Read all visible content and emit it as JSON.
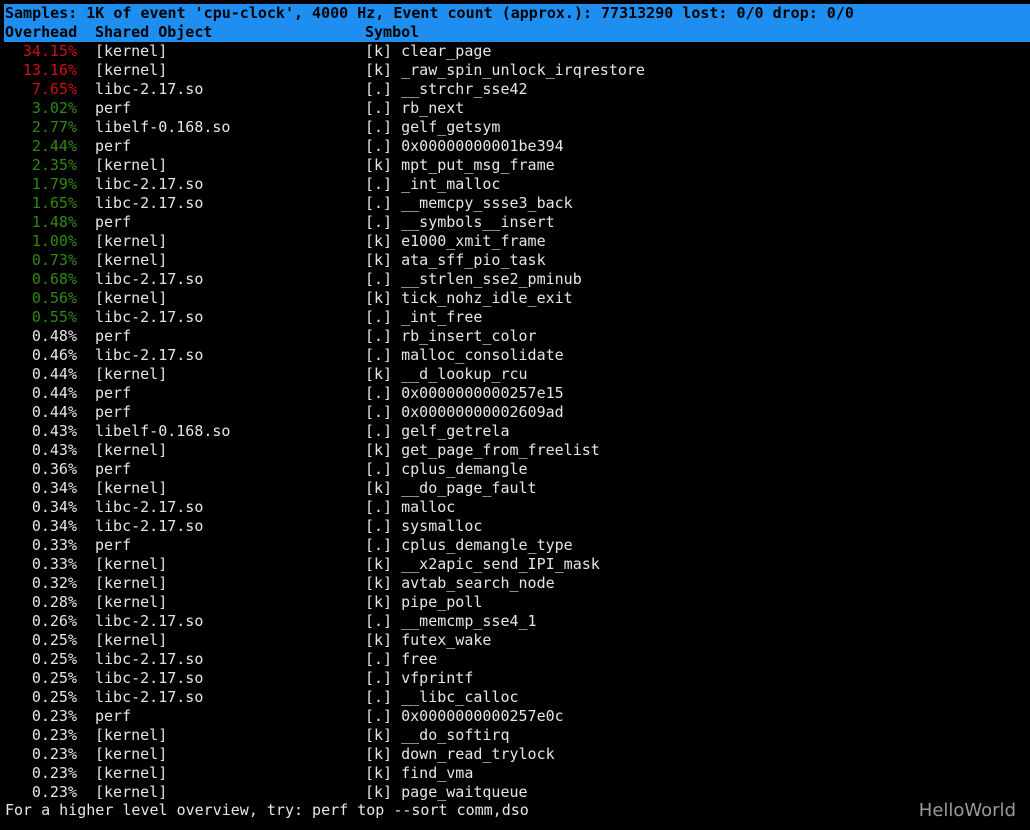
{
  "header": {
    "summary": "Samples: 1K of event 'cpu-clock', 4000 Hz, Event count (approx.): 77313290 lost: 0/0 drop: 0/0",
    "columns": [
      "Overhead",
      "Shared Object",
      "Symbol"
    ]
  },
  "colors": {
    "header_bg": "#1e8ff0",
    "high": "#d01010",
    "medium": "#2f8a10",
    "normal": "#e6e6e6"
  },
  "rows": [
    {
      "overhead": "34.15%",
      "object": "[kernel]",
      "symbol": "[k] clear_page",
      "level": "high"
    },
    {
      "overhead": "13.16%",
      "object": "[kernel]",
      "symbol": "[k] _raw_spin_unlock_irqrestore",
      "level": "high"
    },
    {
      "overhead": "7.65%",
      "object": "libc-2.17.so",
      "symbol": "[.] __strchr_sse42",
      "level": "high"
    },
    {
      "overhead": "3.02%",
      "object": "perf",
      "symbol": "[.] rb_next",
      "level": "medium"
    },
    {
      "overhead": "2.77%",
      "object": "libelf-0.168.so",
      "symbol": "[.] gelf_getsym",
      "level": "medium"
    },
    {
      "overhead": "2.44%",
      "object": "perf",
      "symbol": "[.] 0x00000000001be394",
      "level": "medium"
    },
    {
      "overhead": "2.35%",
      "object": "[kernel]",
      "symbol": "[k] mpt_put_msg_frame",
      "level": "medium"
    },
    {
      "overhead": "1.79%",
      "object": "libc-2.17.so",
      "symbol": "[.] _int_malloc",
      "level": "medium"
    },
    {
      "overhead": "1.65%",
      "object": "libc-2.17.so",
      "symbol": "[.] __memcpy_ssse3_back",
      "level": "medium"
    },
    {
      "overhead": "1.48%",
      "object": "perf",
      "symbol": "[.] __symbols__insert",
      "level": "medium"
    },
    {
      "overhead": "1.00%",
      "object": "[kernel]",
      "symbol": "[k] e1000_xmit_frame",
      "level": "medium"
    },
    {
      "overhead": "0.73%",
      "object": "[kernel]",
      "symbol": "[k] ata_sff_pio_task",
      "level": "medium"
    },
    {
      "overhead": "0.68%",
      "object": "libc-2.17.so",
      "symbol": "[.] __strlen_sse2_pminub",
      "level": "medium"
    },
    {
      "overhead": "0.56%",
      "object": "[kernel]",
      "symbol": "[k] tick_nohz_idle_exit",
      "level": "medium"
    },
    {
      "overhead": "0.55%",
      "object": "libc-2.17.so",
      "symbol": "[.] _int_free",
      "level": "medium"
    },
    {
      "overhead": "0.48%",
      "object": "perf",
      "symbol": "[.] rb_insert_color",
      "level": "normal"
    },
    {
      "overhead": "0.46%",
      "object": "libc-2.17.so",
      "symbol": "[.] malloc_consolidate",
      "level": "normal"
    },
    {
      "overhead": "0.44%",
      "object": "[kernel]",
      "symbol": "[k] __d_lookup_rcu",
      "level": "normal"
    },
    {
      "overhead": "0.44%",
      "object": "perf",
      "symbol": "[.] 0x0000000000257e15",
      "level": "normal"
    },
    {
      "overhead": "0.44%",
      "object": "perf",
      "symbol": "[.] 0x00000000002609ad",
      "level": "normal"
    },
    {
      "overhead": "0.43%",
      "object": "libelf-0.168.so",
      "symbol": "[.] gelf_getrela",
      "level": "normal"
    },
    {
      "overhead": "0.43%",
      "object": "[kernel]",
      "symbol": "[k] get_page_from_freelist",
      "level": "normal"
    },
    {
      "overhead": "0.36%",
      "object": "perf",
      "symbol": "[.] cplus_demangle",
      "level": "normal"
    },
    {
      "overhead": "0.34%",
      "object": "[kernel]",
      "symbol": "[k] __do_page_fault",
      "level": "normal"
    },
    {
      "overhead": "0.34%",
      "object": "libc-2.17.so",
      "symbol": "[.] malloc",
      "level": "normal"
    },
    {
      "overhead": "0.34%",
      "object": "libc-2.17.so",
      "symbol": "[.] sysmalloc",
      "level": "normal"
    },
    {
      "overhead": "0.33%",
      "object": "perf",
      "symbol": "[.] cplus_demangle_type",
      "level": "normal"
    },
    {
      "overhead": "0.33%",
      "object": "[kernel]",
      "symbol": "[k] __x2apic_send_IPI_mask",
      "level": "normal"
    },
    {
      "overhead": "0.32%",
      "object": "[kernel]",
      "symbol": "[k] avtab_search_node",
      "level": "normal"
    },
    {
      "overhead": "0.28%",
      "object": "[kernel]",
      "symbol": "[k] pipe_poll",
      "level": "normal"
    },
    {
      "overhead": "0.26%",
      "object": "libc-2.17.so",
      "symbol": "[.] __memcmp_sse4_1",
      "level": "normal"
    },
    {
      "overhead": "0.25%",
      "object": "[kernel]",
      "symbol": "[k] futex_wake",
      "level": "normal"
    },
    {
      "overhead": "0.25%",
      "object": "libc-2.17.so",
      "symbol": "[.] free",
      "level": "normal"
    },
    {
      "overhead": "0.25%",
      "object": "libc-2.17.so",
      "symbol": "[.] vfprintf",
      "level": "normal"
    },
    {
      "overhead": "0.25%",
      "object": "libc-2.17.so",
      "symbol": "[.] __libc_calloc",
      "level": "normal"
    },
    {
      "overhead": "0.23%",
      "object": "perf",
      "symbol": "[.] 0x0000000000257e0c",
      "level": "normal"
    },
    {
      "overhead": "0.23%",
      "object": "[kernel]",
      "symbol": "[k] __do_softirq",
      "level": "normal"
    },
    {
      "overhead": "0.23%",
      "object": "[kernel]",
      "symbol": "[k] down_read_trylock",
      "level": "normal"
    },
    {
      "overhead": "0.23%",
      "object": "[kernel]",
      "symbol": "[k] find_vma",
      "level": "normal"
    },
    {
      "overhead": "0.23%",
      "object": "[kernel]",
      "symbol": "[k] page_waitqueue",
      "level": "normal"
    }
  ],
  "footer": "For a higher level overview, try: perf top --sort comm,dso",
  "watermark": "HelloWorld"
}
